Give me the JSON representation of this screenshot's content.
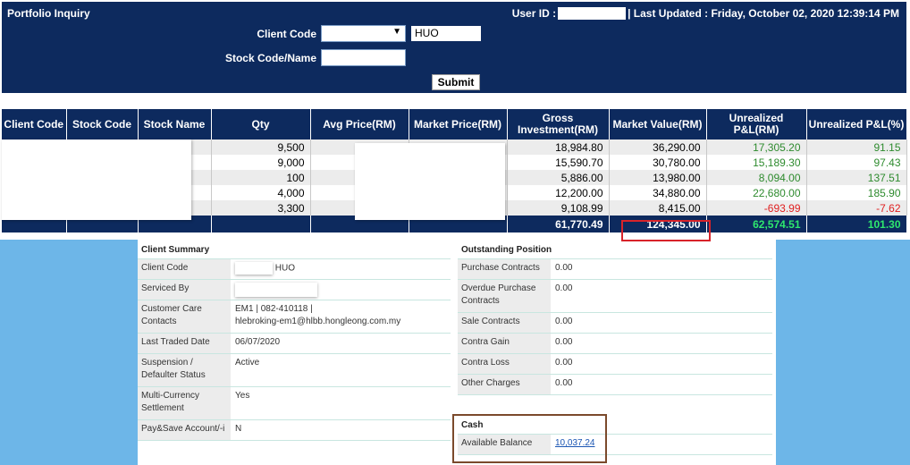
{
  "header": {
    "title": "Portfolio Inquiry",
    "user_id_label": "User ID :",
    "last_updated": "| Last Updated : Friday, October 02, 2020 12:39:14 PM"
  },
  "form": {
    "client_code_label": "Client Code",
    "client_code_value": "HUO",
    "stock_code_label": "Stock Code/Name",
    "stock_code_value": "",
    "submit_label": "Submit"
  },
  "table": {
    "columns": [
      "Client Code",
      "Stock Code",
      "Stock Name",
      "Qty",
      "Avg Price(RM)",
      "Market Price(RM)",
      "Gross Investment(RM)",
      "Market Value(RM)",
      "Unrealized P&L(RM)",
      "Unrealized P&L(%)"
    ],
    "rows": [
      {
        "qty": "9,500",
        "gross": "18,984.80",
        "market_value": "36,290.00",
        "pl_rm": "17,305.20",
        "pl_pct": "91.15",
        "sign": "pos"
      },
      {
        "qty": "9,000",
        "gross": "15,590.70",
        "market_value": "30,780.00",
        "pl_rm": "15,189.30",
        "pl_pct": "97.43",
        "sign": "pos"
      },
      {
        "qty": "100",
        "gross": "5,886.00",
        "market_value": "13,980.00",
        "pl_rm": "8,094.00",
        "pl_pct": "137.51",
        "sign": "pos"
      },
      {
        "qty": "4,000",
        "gross": "12,200.00",
        "market_value": "34,880.00",
        "pl_rm": "22,680.00",
        "pl_pct": "185.90",
        "sign": "pos"
      },
      {
        "qty": "3,300",
        "gross": "9,108.99",
        "market_value": "8,415.00",
        "pl_rm": "-693.99",
        "pl_pct": "-7.62",
        "sign": "neg"
      }
    ],
    "totals": {
      "gross": "61,770.49",
      "market_value": "124,345.00",
      "pl_rm": "62,574.51",
      "pl_pct": "101.30"
    }
  },
  "client_summary": {
    "title": "Client Summary",
    "client_code_label": "Client Code",
    "client_code_value": "HUO",
    "serviced_by_label": "Serviced By",
    "care_label": "Customer Care Contacts",
    "care_line1": "EM1 | 082-410118 |",
    "care_line2": "hlebroking-em1@hlbb.hongleong.com.my",
    "last_traded_label": "Last Traded Date",
    "last_traded_value": "06/07/2020",
    "suspension_label": "Suspension / Defaulter Status",
    "suspension_value": "Active",
    "multi_currency_label": "Multi-Currency Settlement",
    "multi_currency_value": "Yes",
    "paysave_label": "Pay&Save Account/-i",
    "paysave_value": "N"
  },
  "outstanding": {
    "title": "Outstanding Position",
    "items": [
      {
        "label": "Purchase Contracts",
        "value": "0.00"
      },
      {
        "label": "Overdue Purchase Contracts",
        "value": "0.00"
      },
      {
        "label": "Sale Contracts",
        "value": "0.00"
      },
      {
        "label": "Contra Gain",
        "value": "0.00"
      },
      {
        "label": "Contra Loss",
        "value": "0.00"
      },
      {
        "label": "Other Charges",
        "value": "0.00"
      }
    ]
  },
  "cash": {
    "title": "Cash",
    "available_label": "Available Balance",
    "available_value": "10,037.24"
  },
  "colors": {
    "header_bg": "#0d2a5e",
    "side_bg": "#6db6e8",
    "positive": "#2e8b2e",
    "negative": "#e02020",
    "highlight_red": "#d8232a",
    "highlight_brown": "#7b4a2c"
  }
}
